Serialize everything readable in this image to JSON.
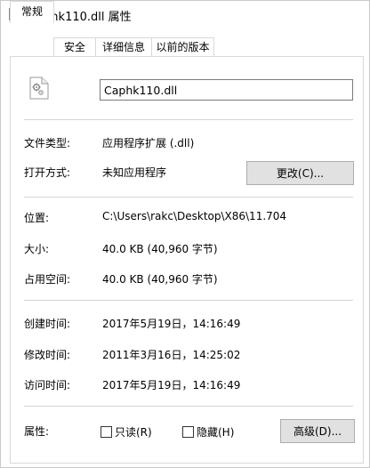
{
  "window": {
    "title": "Caphk110.dll 属性",
    "icon": "dll-file-icon"
  },
  "tabs": [
    {
      "label": "常规",
      "active": true
    },
    {
      "label": "安全",
      "active": false
    },
    {
      "label": "详细信息",
      "active": false
    },
    {
      "label": "以前的版本",
      "active": false
    }
  ],
  "general": {
    "filename": "Caphk110.dll",
    "file_icon": "dll-gear-file-icon",
    "file_type": {
      "label": "文件类型:",
      "value": "应用程序扩展 (.dll)"
    },
    "opens_with": {
      "label": "打开方式:",
      "value": "未知应用程序",
      "change_button": "更改(C)..."
    },
    "location": {
      "label": "位置:",
      "value": "C:\\Users\\rakc\\Desktop\\X86\\11.704"
    },
    "size": {
      "label": "大小:",
      "value": "40.0 KB (40,960 字节)"
    },
    "size_on_disk": {
      "label": "占用空间:",
      "value": "40.0 KB (40,960 字节)"
    },
    "created": {
      "label": "创建时间:",
      "value": "2017年5月19日，14:16:49"
    },
    "modified": {
      "label": "修改时间:",
      "value": "2011年3月16日，14:25:02"
    },
    "accessed": {
      "label": "访问时间:",
      "value": "2017年5月19日，14:16:49"
    },
    "attributes": {
      "label": "属性:",
      "readonly": {
        "label": "只读(R)",
        "checked": false
      },
      "hidden": {
        "label": "隐藏(H)",
        "checked": false
      },
      "advanced_button": "高级(D)..."
    }
  }
}
